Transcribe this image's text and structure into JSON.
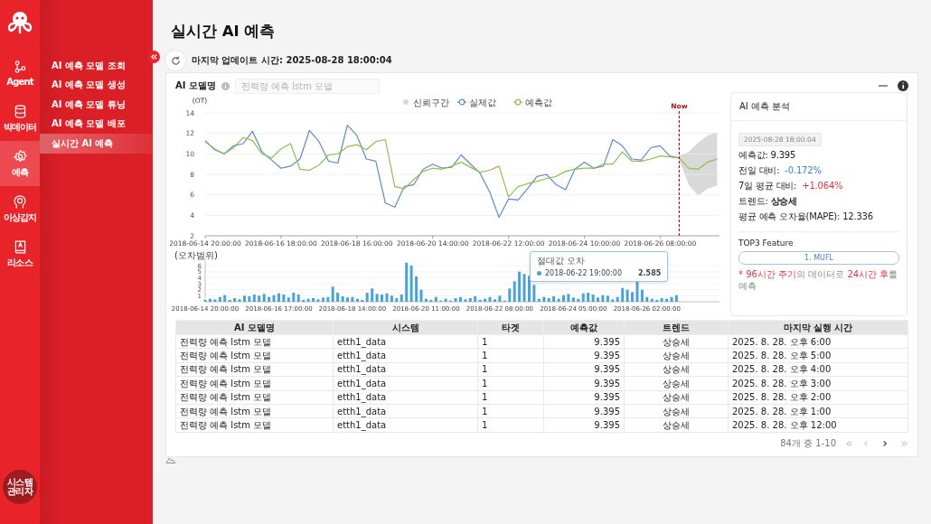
{
  "sidebar": {
    "rail": [
      {
        "label": "Agent",
        "kind": "agent",
        "selected": false
      },
      {
        "label": "빅데이터",
        "kind": "data",
        "selected": false
      },
      {
        "label": "예측",
        "kind": "forecast",
        "selected": true
      },
      {
        "label": "이상감지",
        "kind": "anomaly",
        "selected": false
      },
      {
        "label": "리소스",
        "kind": "resource",
        "selected": false
      }
    ],
    "user": "시스템 관리자",
    "submenu": [
      {
        "label": "AI 예측 모델 조회",
        "selected": false
      },
      {
        "label": "AI 예측 모델 생성",
        "selected": false
      },
      {
        "label": "AI 예측 모델 튜닝",
        "selected": false
      },
      {
        "label": "AI 예측 모델 배포",
        "selected": false
      },
      {
        "label": "실시간 AI 예측",
        "selected": true
      }
    ]
  },
  "page": {
    "title": "실시간 AI 예측",
    "last_update": "마지막 업데이트 시간: 2025-08-28 18:00:04"
  },
  "model_field": {
    "label": "AI 모델명",
    "placeholder": "전력량 예측 lstm 모델"
  },
  "forecast_chart": {
    "confidence_band": {
      "label": "신뢰구간",
      "color": "#d9d9d9"
    },
    "chart_data": {
      "type": "line",
      "ylabel": "(OT)",
      "categories": [
        "2018-06-14 20:00:00",
        null,
        null,
        null,
        null,
        null,
        null,
        null,
        "2018-06-16 18:00:00",
        null,
        null,
        null,
        null,
        null,
        null,
        null,
        "2018-06-18 16:00:00",
        null,
        null,
        null,
        null,
        null,
        null,
        null,
        "2018-06-20 14:00:00",
        null,
        null,
        null,
        null,
        null,
        null,
        null,
        "2018-06-22 12:00:00",
        null,
        null,
        null,
        null,
        null,
        null,
        null,
        "2018-06-24 10:00:00",
        null,
        null,
        null,
        null,
        null,
        null,
        null,
        "2018-06-26 08:00:00",
        null,
        null,
        null,
        null,
        null,
        null
      ],
      "series": [
        {
          "name": "실제값",
          "color": "#5b8dc4",
          "type": "line",
          "values": [
            11.3,
            10.4,
            10.0,
            10.8,
            11.0,
            12.2,
            10.2,
            9.4,
            8.6,
            8.8,
            9.5,
            12.3,
            11.2,
            9.3,
            9.1,
            12.8,
            11.8,
            9.5,
            9.3,
            5.2,
            4.8,
            6.8,
            7.0,
            8.5,
            9.0,
            8.6,
            8.7,
            9.9,
            9.0,
            8.1,
            6.3,
            3.8,
            5.6,
            5.5,
            6.6,
            7.8,
            8.0,
            7.0,
            6.5,
            8.5,
            9.2,
            8.6,
            8.8,
            11.4,
            10.8,
            9.5,
            9.4,
            10.6,
            10.8,
            9.8,
            9.6,
            null,
            null,
            null,
            null
          ]
        },
        {
          "name": "예측값",
          "color": "#8dc04f",
          "type": "line",
          "values": [
            11.2,
            10.5,
            10.0,
            10.6,
            11.6,
            11.3,
            10.0,
            9.6,
            10.5,
            11.0,
            8.5,
            8.4,
            8.9,
            9.9,
            10.0,
            10.7,
            10.9,
            10.4,
            11.2,
            11.4,
            6.8,
            6.6,
            7.5,
            8.3,
            8.6,
            8.5,
            8.8,
            9.2,
            8.7,
            8.2,
            8.4,
            8.8,
            5.8,
            6.8,
            7.1,
            7.3,
            7.6,
            7.8,
            8.3,
            8.5,
            8.6,
            8.6,
            9.0,
            9.0,
            10.2,
            9.3,
            9.3,
            9.5,
            9.8,
            9.7,
            9.6,
            8.6,
            8.5,
            9.2,
            9.5
          ]
        }
      ],
      "ylim": [
        2,
        14
      ],
      "yticks": [
        2,
        4,
        6,
        8,
        10,
        12,
        14
      ],
      "annotations": [
        {
          "text": "Now"
        }
      ],
      "grid": true,
      "legend": true
    }
  },
  "error_chart": {
    "chart_data": {
      "type": "bar",
      "ylabel": "(오차범위)",
      "categories": [
        "2018-06-14 20:00:00",
        null,
        null,
        null,
        null,
        null,
        null,
        null,
        null,
        null,
        null,
        null,
        null,
        null,
        null,
        "2018-06-16 17:00:00",
        null,
        null,
        null,
        null,
        null,
        null,
        null,
        null,
        null,
        null,
        null,
        null,
        null,
        null,
        "2018-06-18 14:00:00",
        null,
        null,
        null,
        null,
        null,
        null,
        null,
        null,
        null,
        null,
        null,
        null,
        null,
        null,
        "2018-06-20 11:00:00",
        null,
        null,
        null,
        null,
        null,
        null,
        null,
        null,
        null,
        null,
        null,
        null,
        null,
        null,
        "2018-06-22 08:00:00",
        null,
        null,
        null,
        null,
        null,
        null,
        null,
        null,
        null,
        null,
        null,
        null,
        null,
        null,
        "2018-06-24 05:00:00",
        null,
        null,
        null,
        null,
        null,
        null,
        null,
        null,
        null,
        null,
        null,
        null,
        null,
        null,
        "2018-06-26 02:00:00",
        null,
        null,
        null,
        null,
        null,
        null
      ],
      "series": [
        {
          "name": "절대값 오차",
          "color": "#4aa3d6",
          "values": [
            0.3,
            0.5,
            0.4,
            0.8,
            1.1,
            0.3,
            0.6,
            0.4,
            1.0,
            0.9,
            1.2,
            1.0,
            1.3,
            0.8,
            1.1,
            1.4,
            1.2,
            0.7,
            1.5,
            1.2,
            0.3,
            0.5,
            0.6,
            0.4,
            0.7,
            0.8,
            2.5,
            1.5,
            0.9,
            0.7,
            0.8,
            0.5,
            0.3,
            1.5,
            2.2,
            1.3,
            1.2,
            1.4,
            1.0,
            0.6,
            1.2,
            6.5,
            6.0,
            4.2,
            2.0,
            0.5,
            0.3,
            0.8,
            0.2,
            0.5,
            0.2,
            0.6,
            0.8,
            0.4,
            0.6,
            0.9,
            0.3,
            0.5,
            0.8,
            0.4,
            1.0,
            0.2,
            2.2,
            3.4,
            5.0,
            4.6,
            4.3,
            2.8,
            0.5,
            0.8,
            0.6,
            0.9,
            0.5,
            1.1,
            1.3,
            0.7,
            0.5,
            1.4,
            1.5,
            1.2,
            0.7,
            1.1,
            1.0,
            0.4,
            0.8,
            2.3,
            2.0,
            1.6,
            3.4,
            2.0,
            0.8,
            0.5,
            0.3,
            0.6,
            0.5,
            0.8,
            1.1
          ]
        }
      ],
      "ylim": [
        0,
        6.6
      ],
      "yticks": [
        1,
        2,
        3,
        4,
        5,
        6
      ],
      "grid": true
    },
    "tooltip": {
      "time": "2018-06-22 19:00:00",
      "value": "2.585"
    }
  },
  "analysis": {
    "title": "AI 예측 분석",
    "timestamp": "2025-08-28 18:00:04",
    "stats": [
      {
        "label": "예측값:",
        "value": "9.395",
        "kind": "plain"
      },
      {
        "label": "전일 대비:",
        "value": "-0.172%",
        "kind": "down"
      },
      {
        "label": "7일 평균 대비:",
        "value": "+1.064%",
        "kind": "up"
      },
      {
        "label": "트렌드:",
        "value": "상승세",
        "kind": "bold"
      },
      {
        "label": "평균 예측 오차율(MAPE):",
        "value": "12.336",
        "kind": "plain"
      }
    ],
    "features_title": "TOP3 Feature",
    "features": [
      "1. MUFL"
    ],
    "note": [
      {
        "text": "* 96시간 주기",
        "highlight": true
      },
      {
        "text": "의 데이터로 ",
        "highlight": false
      },
      {
        "text": "24시간 후",
        "highlight": true
      },
      {
        "text": "를 예측",
        "highlight": false
      }
    ]
  },
  "table": {
    "columns": [
      "AI 모델명",
      "시스템",
      "타겟",
      "예측값",
      "트렌드",
      "마지막 실행 시간"
    ],
    "rows": [
      [
        "전력량 예측 lstm 모델",
        "etth1_data",
        "1",
        "9.395",
        "상승세",
        "2025. 8. 28. 오후 6:00"
      ],
      [
        "전력량 예측 lstm 모델",
        "etth1_data",
        "1",
        "9.395",
        "상승세",
        "2025. 8. 28. 오후 5:00"
      ],
      [
        "전력량 예측 lstm 모델",
        "etth1_data",
        "1",
        "9.395",
        "상승세",
        "2025. 8. 28. 오후 4:00"
      ],
      [
        "전력량 예측 lstm 모델",
        "etth1_data",
        "1",
        "9.395",
        "상승세",
        "2025. 8. 28. 오후 3:00"
      ],
      [
        "전력량 예측 lstm 모델",
        "etth1_data",
        "1",
        "9.395",
        "상승세",
        "2025. 8. 28. 오후 2:00"
      ],
      [
        "전력량 예측 lstm 모델",
        "etth1_data",
        "1",
        "9.395",
        "상승세",
        "2025. 8. 28. 오후 1:00"
      ],
      [
        "전력량 예측 lstm 모델",
        "etth1_data",
        "1",
        "9.395",
        "상승세",
        "2025. 8. 28. 오후 12:00"
      ]
    ]
  },
  "pagination": {
    "summary": "84개 중 1-10",
    "buttons": [
      {
        "kind": "first",
        "disabled": true
      },
      {
        "kind": "prev",
        "disabled": true
      },
      {
        "kind": "next",
        "disabled": false
      },
      {
        "kind": "last",
        "disabled": true
      }
    ]
  }
}
